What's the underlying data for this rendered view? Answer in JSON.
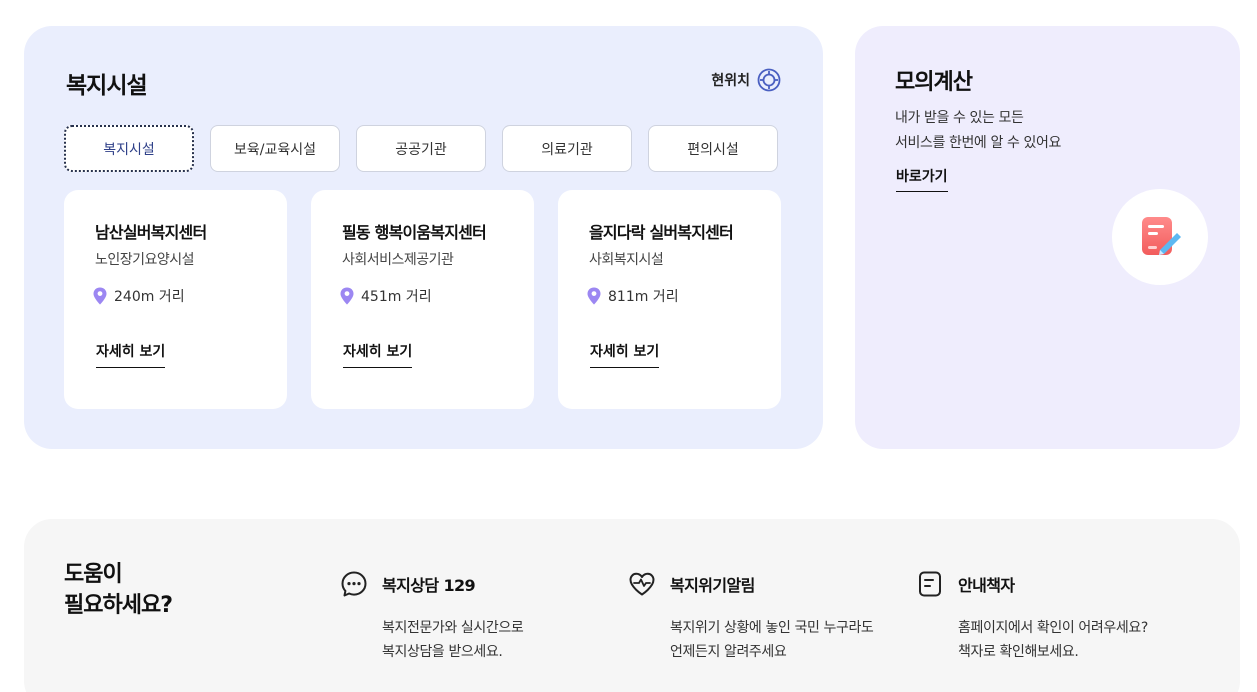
{
  "welfare": {
    "title": "복지시설",
    "location_label": "현위치",
    "tabs": [
      {
        "label": "복지시설",
        "active": true
      },
      {
        "label": "보육/교육시설",
        "active": false
      },
      {
        "label": "공공기관",
        "active": false
      },
      {
        "label": "의료기관",
        "active": false
      },
      {
        "label": "편의시설",
        "active": false
      }
    ],
    "cards": [
      {
        "name": "남산실버복지센터",
        "type": "노인장기요양시설",
        "distance": "240m 거리",
        "link": "자세히 보기"
      },
      {
        "name": "필동 행복이움복지센터",
        "type": "사회서비스제공기관",
        "distance": "451m 거리",
        "link": "자세히 보기"
      },
      {
        "name": "을지다락 실버복지센터",
        "type": "사회복지시설",
        "distance": "811m 거리",
        "link": "자세히 보기"
      }
    ]
  },
  "calc": {
    "title": "모의계산",
    "desc_line1": "내가 받을 수 있는 모든",
    "desc_line2": "서비스를 한번에 알 수 있어요",
    "link": "바로가기",
    "icon": "document-pencil-icon"
  },
  "help": {
    "title_line1": "도움이",
    "title_line2": "필요하세요?",
    "items": [
      {
        "icon": "chat-bubble-icon",
        "title": "복지상담 129",
        "desc_line1": "복지전문가와 실시간으로",
        "desc_line2": "복지상담을 받으세요."
      },
      {
        "icon": "heart-pulse-icon",
        "title": "복지위기알림",
        "desc_line1": "복지위기 상황에 놓인 국민 누구라도",
        "desc_line2": "언제든지 알려주세요"
      },
      {
        "icon": "document-icon",
        "title": "안내책자",
        "desc_line1": "홈페이지에서 확인이 어려우세요?",
        "desc_line2": "책자로 확인해보세요."
      }
    ]
  },
  "colors": {
    "welfare_bg": "#eaeefd",
    "calc_bg": "#efedfd",
    "help_bg": "#f6f6f6",
    "pin": "#9c87f2",
    "location_icon": "#4a5fc1",
    "active_tab_text": "#2e3f88"
  }
}
